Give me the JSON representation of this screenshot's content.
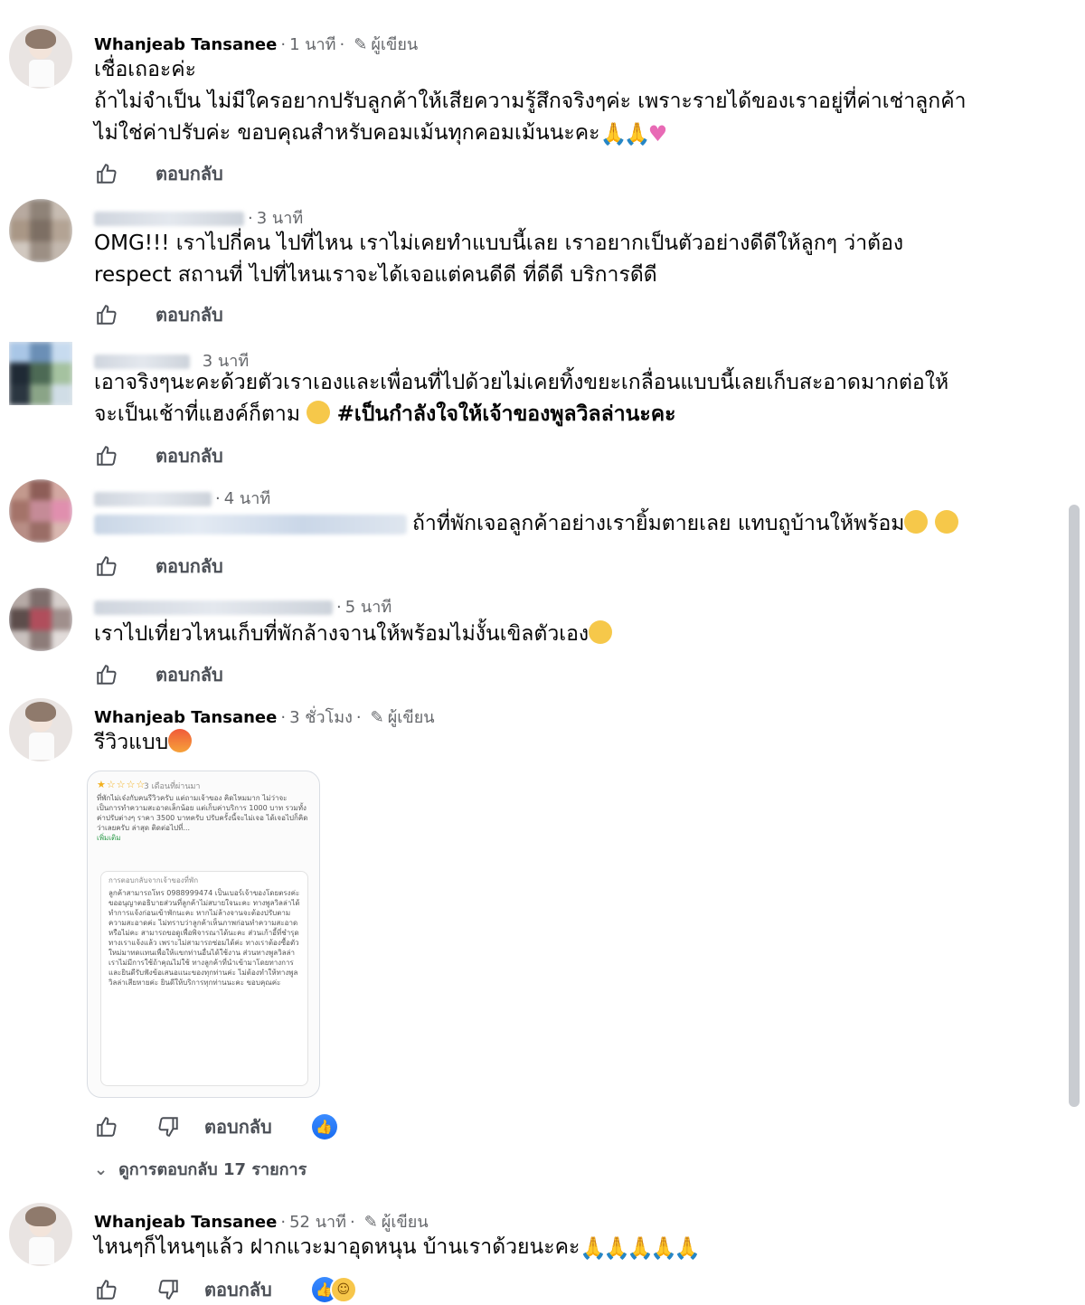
{
  "comments": [
    {
      "author": "Whanjeab Tansanee",
      "time": "1 นาที",
      "author_badge": "ผู้เขียน",
      "lines": [
        "เชื่อเถอะค่ะ",
        "ถ้าไม่จำเป็น ไม่มีใครอยากปรับลูกค้าให้เสียความรู้สึกจริงๆค่ะ เพราะรายได้ของเราอยู่ที่ค่าเช่าลูกค้า",
        "ไม่ใช่ค่าปรับค่ะ ขอบคุณสำหรับคอมเม้นทุกคอมเม้นนะคะ"
      ],
      "reply_label": "ตอบกลับ"
    },
    {
      "time": "3 นาที",
      "lines": [
        "OMG!!! เราไปกี่คน ไปที่ไหน เราไม่เคยทำแบบนี้เลย เราอยากเป็นตัวอย่างดีดีให้ลูกๆ ว่าต้อง",
        "respect สถานที่ ไปที่ไหนเราจะได้เจอแต่คนดีดี ที่ดีดี บริการดีดี"
      ],
      "reply_label": "ตอบกลับ"
    },
    {
      "time": "3 นาที",
      "lines": [
        "เอาจริงๆนะคะด้วยตัวเราเองและเพื่อนที่ไปด้วยไม่เคยทิ้งขยะเกลื่อนแบบนี้เลยเก็บสะอาดมากต่อให้",
        "จะเป็นเช้าที่แฮงค์ก็ตาม"
      ],
      "hashtag": "#เป็นกำลังใจให้เจ้าของพูลวิลล่านะคะ",
      "reply_label": "ตอบกลับ"
    },
    {
      "time": "4 นาที",
      "lines": [
        "ถ้าที่พักเจอลูกค้าอย่างเรายิ้มตายเลย แทบถูบ้านให้พร้อม"
      ],
      "reply_label": "ตอบกลับ"
    },
    {
      "time": "5 นาที",
      "lines": [
        "เราไปเที่ยวไหนเก็บที่พักล้างจานให้พร้อมไม่งั้นเขิลตัวเอง"
      ],
      "reply_label": "ตอบกลับ"
    },
    {
      "author": "Whanjeab Tansanee",
      "time": "3 ชั่วโมง",
      "author_badge": "ผู้เขียน",
      "lines": [
        "รีวิวแบบ"
      ],
      "attachment": {
        "stars": "★☆☆☆☆",
        "header": "3 เดือนที่ผ่านมา",
        "review_text": "ที่พักไม่เจ๋งกับคนรีวิวครับ แต่ถามเจ้าของ คิดไหมมาก ไม่ว่าจะเป็นการทำความสะอาดเล็กน้อย แต่เก็บค่าบริการ 1000 บาท รวมทั้งค่าปรับต่างๆ ราคา 3500 บาทครับ ปรับครั้งนี้จะไม่เจอ ได้เจอไปก็คิดว่าเลยครับ ล่าสุด ติดต่อไปที่...",
        "more_label": "เพิ่มเติม",
        "reply_header": "การตอบกลับจากเจ้าของที่พัก",
        "reply_text": "ลูกค้าสามารถโทร 0988999474 เป็นเบอร์เจ้าของโดยตรงค่ะ ขออนุญาตอธิบายส่วนที่ลูกค้าไม่สบายใจนะคะ ทางพูลวิลล่าได้ทำการแจ้งก่อนเข้าพักนะคะ หากไม่ล้างจานจะต้องปรับตามความสะอาดค่ะ ไม่ทราบว่าลูกค้าเห็นภาพก่อนทำความสะอาดหรือไม่คะ สามารถขอดูเพื่อพิจารณาได้นะคะ ส่วนเก้าอี้ที่ชำรุดทางเราแจ้งแล้ว เพราะไม่สามารถซ่อมได้ค่ะ ทางเราต้องซื้อตัวใหม่มาทดแทนเพื่อให้แขกท่านอื่นได้ใช้งาน ส่วนทางพูลวิลล่าเราไม่มีการใช้ถ้าคุณไม่ใช้ ทางลูกค้าที่นำเข้ามาโดยทางการ และยินดีรับฟังข้อเสนอแนะของทุกท่านค่ะ ไม่ต้องทำให้ทางพูลวิลล่าเสียหายค่ะ ยินดีให้บริการทุกท่านนะคะ ขอบคุณค่ะ"
      },
      "reply_label": "ตอบกลับ",
      "view_replies": "ดูการตอบกลับ 17 รายการ"
    },
    {
      "author": "Whanjeab Tansanee",
      "time": "52 นาที",
      "author_badge": "ผู้เขียน",
      "lines": [
        "ไหนๆก็ไหนๆแล้ว ฝากแวะมาอุดหนุน บ้านเราด้วยนะคะ"
      ],
      "reply_label": "ตอบกลับ"
    }
  ],
  "icons": {
    "like": "thumbs-up-icon",
    "dislike": "thumbs-down-icon",
    "pen": "pen-icon",
    "chevron": "chevron-down-icon",
    "pray": "pray-emoji",
    "heart": "pink-heart-emoji",
    "smile": "smile-emoji",
    "angry": "angry-emoji",
    "laugh": "laugh-emoji",
    "like_reaction": "like-reaction-icon",
    "haha_reaction": "haha-reaction-icon"
  },
  "colors": {
    "accent_blue": "#1877f2",
    "text": "#050505",
    "meta": "#65676b"
  }
}
